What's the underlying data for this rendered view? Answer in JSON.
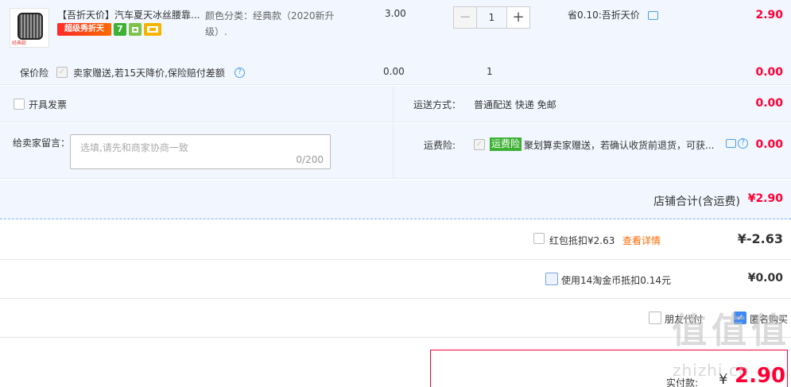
{
  "item": {
    "title": "【吾折天价】汽车夏天冰丝腰靠...",
    "thumb_caption": "经典款",
    "badges": {
      "sale": "超级秀折天",
      "seven": "7",
      "shop_icon": "shop-icon",
      "card_icon": "card-icon"
    },
    "sku": "颜色分类：经典款（2020新升级）.",
    "price": "3.00",
    "qty": {
      "minus": "−",
      "value": "1",
      "plus": "+"
    },
    "save": "省0.10:吾折天价",
    "total": "2.90"
  },
  "insurance": {
    "label": "保价险",
    "check": "✓",
    "desc": "卖家赠送,若15天降价,保险赔付差额",
    "help": "?",
    "price": "0.00",
    "qty": "1",
    "total": "0.00"
  },
  "invoice": {
    "label": "开具发票"
  },
  "shipping": {
    "label": "运送方式：",
    "value": "普通配送 快递 免邮",
    "total": "0.00"
  },
  "message": {
    "label": "给卖家留言：",
    "placeholder": "选填,请先和商家协商一致",
    "count": "0/200"
  },
  "freight_insurance": {
    "label": "运费险:",
    "check": "✓",
    "tag": "运费险",
    "desc": "聚划算卖家赠送，若确认收货前退货，可获...",
    "help": "?",
    "total": "0.00"
  },
  "shop_total": {
    "label": "店铺合计(含运费)",
    "value": "¥2.90"
  },
  "red_packet": {
    "label": "红包抵扣¥2.63",
    "link": "查看详情",
    "value": "¥-2.63"
  },
  "coins": {
    "label": "使用14淘金币抵扣0.14元",
    "value": "¥0.00"
  },
  "options": {
    "friend_pay": "朋友代付",
    "anonymous": "匿名购买",
    "anonymous_check": "✓"
  },
  "payment": {
    "label": "实付款:",
    "currency": "¥",
    "value": "2.90"
  },
  "watermark": {
    "chars": [
      "值",
      "值",
      "值"
    ],
    "url": "zhizhi.cn"
  },
  "colors": {
    "accent_red": "#ff0036",
    "row_bg": "#f2f7ff",
    "link_blue": "#3c89f5",
    "tag_green": "#3eb135"
  }
}
